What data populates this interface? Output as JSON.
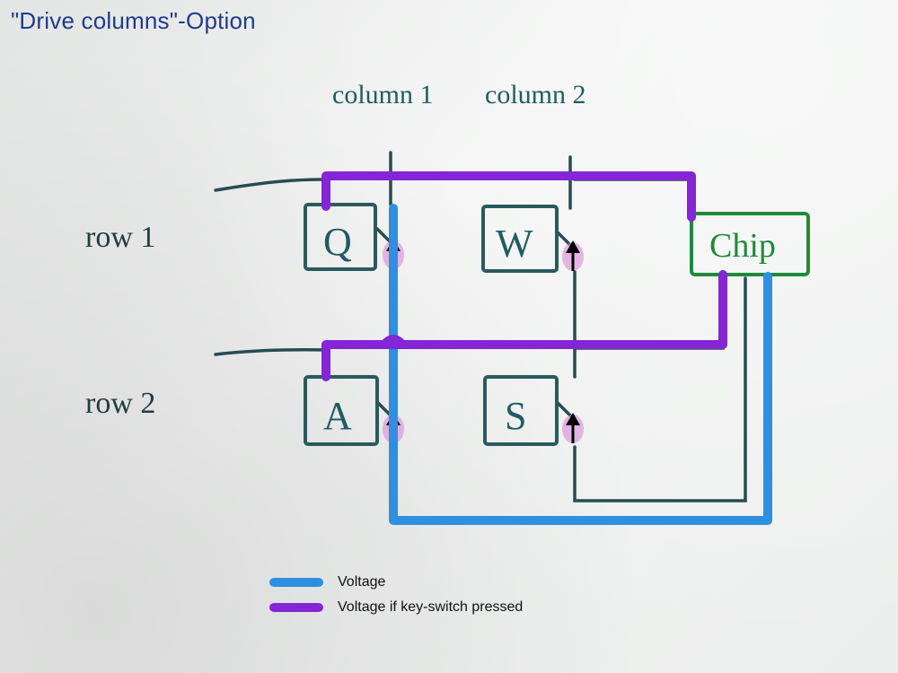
{
  "title": "\"Drive columns\"-Option",
  "columns": {
    "col1": "column 1",
    "col2": "column 2"
  },
  "rows": {
    "row1": "row 1",
    "row2": "row 2"
  },
  "keys": {
    "q": "Q",
    "w": "W",
    "a": "A",
    "s": "S"
  },
  "chip": "Chip",
  "legend": {
    "voltage": "Voltage",
    "voltage_pressed": "Voltage if key-switch pressed"
  },
  "colors": {
    "voltage": "#2f8fe0",
    "voltage_pressed": "#8425d6",
    "ink": "#274c51",
    "chip": "#1f8a3a",
    "diode_glow": "#d98bd9"
  }
}
